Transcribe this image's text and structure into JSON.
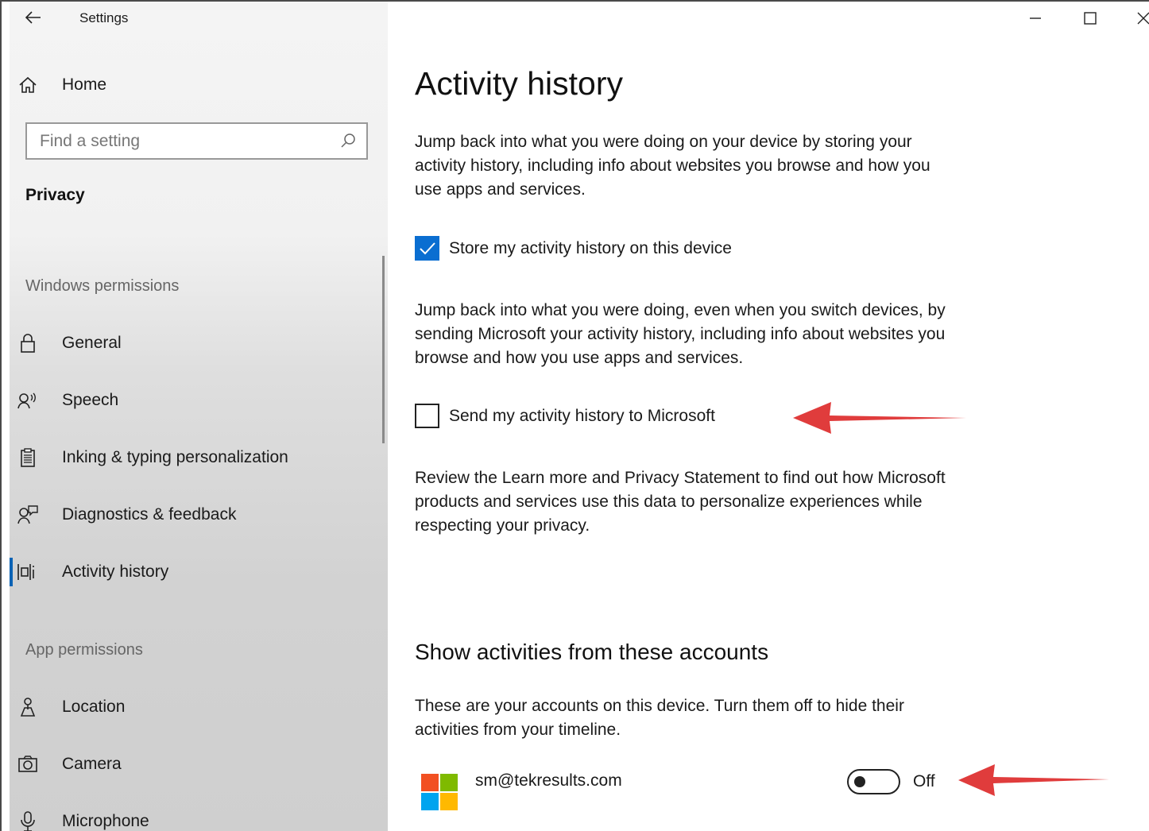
{
  "window": {
    "title": "Settings",
    "controls": {
      "minimize": "minimize-icon",
      "maximize": "maximize-icon",
      "close": "close-icon"
    }
  },
  "sidebar": {
    "home_label": "Home",
    "search_placeholder": "Find a setting",
    "section_title": "Privacy",
    "groups": [
      {
        "title": "Windows permissions",
        "items": [
          {
            "label": "General",
            "icon": "lock-icon"
          },
          {
            "label": "Speech",
            "icon": "speech-icon"
          },
          {
            "label": "Inking & typing personalization",
            "icon": "clipboard-icon"
          },
          {
            "label": "Diagnostics & feedback",
            "icon": "feedback-icon"
          },
          {
            "label": "Activity history",
            "icon": "timeline-icon",
            "selected": true
          }
        ]
      },
      {
        "title": "App permissions",
        "items": [
          {
            "label": "Location",
            "icon": "location-icon"
          },
          {
            "label": "Camera",
            "icon": "camera-icon"
          },
          {
            "label": "Microphone",
            "icon": "microphone-icon"
          }
        ]
      }
    ]
  },
  "main": {
    "title": "Activity history",
    "intro": "Jump back into what you were doing on your device by storing your activity history, including info about websites you browse and how you use apps and services.",
    "store_checkbox": {
      "label": "Store my activity history on this device",
      "checked": true
    },
    "send_intro": "Jump back into what you were doing, even when you switch devices, by sending Microsoft your activity history, including info about websites you browse and how you use apps and services.",
    "send_checkbox": {
      "label": "Send my activity history to Microsoft",
      "checked": false
    },
    "review_text": "Review the Learn more and Privacy Statement to find out how Microsoft products and services use this data to personalize experiences while respecting your privacy.",
    "accounts_title": "Show activities from these accounts",
    "accounts_desc": "These are your accounts on this device. Turn them off to hide their activities from your timeline.",
    "accounts": [
      {
        "email": "sm@tekresults.com",
        "toggle_state": "Off",
        "on": false
      }
    ]
  },
  "colors": {
    "accent": "#0a6ed1",
    "annotation_arrow": "#e03c3c"
  }
}
